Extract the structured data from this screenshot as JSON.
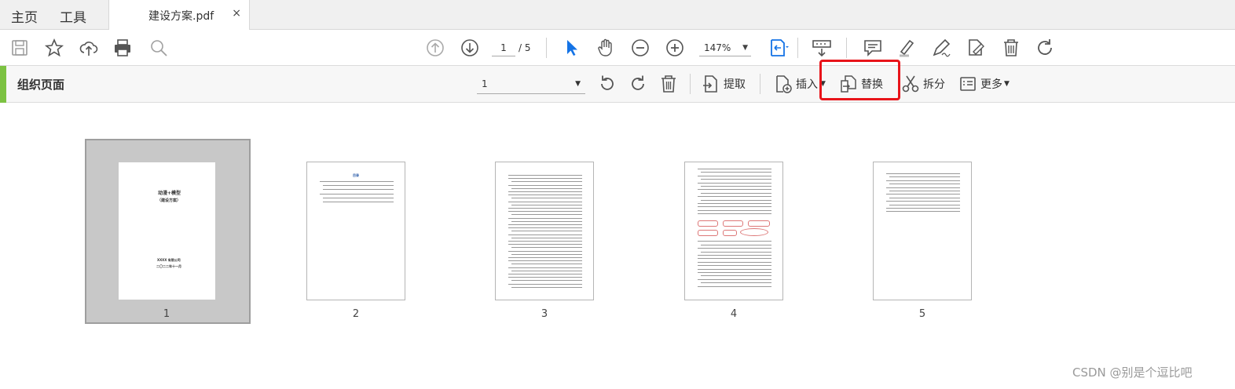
{
  "tabs": {
    "home": "主页",
    "tools": "工具",
    "document": "建设方案.pdf",
    "close": "×"
  },
  "toolbar": {
    "page_current": "1",
    "page_total": "/ 5",
    "zoom": "147%"
  },
  "organize": {
    "title": "组织页面",
    "page_select": "1",
    "extract": "提取",
    "insert": "插入",
    "replace": "替换",
    "split": "拆分",
    "more": "更多"
  },
  "pages": [
    {
      "number": "1",
      "title": "动漫+模型",
      "subtitle": "（建设方案）",
      "footer1": "XXXX 有限公司",
      "footer2": "二〇二二年十一月"
    },
    {
      "number": "2",
      "heading": "目录"
    },
    {
      "number": "3"
    },
    {
      "number": "4"
    },
    {
      "number": "5"
    }
  ],
  "watermark": "CSDN @别是个逗比吧",
  "colors": {
    "accent_green": "#7cc242",
    "highlight_red": "#e8141a",
    "icon_blue": "#1473e6"
  }
}
